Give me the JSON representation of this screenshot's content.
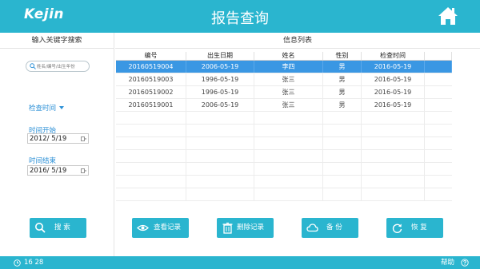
{
  "header": {
    "logo": "Kejin",
    "title": "报告查询"
  },
  "left_panel": {
    "title": "输入关键字搜索",
    "search_placeholder": "姓名/编号/出生年份",
    "filter_label": "检查时间",
    "start_label": "时间开始",
    "start_value": "2012/  5/19",
    "end_label": "时间结束",
    "end_value": "2016/  5/19"
  },
  "info_list": {
    "title": "信息列表",
    "columns": [
      "编号",
      "出生日期",
      "姓名",
      "性别",
      "检查时间"
    ],
    "rows": [
      [
        "20160519004",
        "2006-05-19",
        "李四",
        "男",
        "2016-05-19"
      ],
      [
        "20160519003",
        "1996-05-19",
        "张三",
        "男",
        "2016-05-19"
      ],
      [
        "20160519002",
        "1996-05-19",
        "张三",
        "男",
        "2016-05-19"
      ],
      [
        "20160519001",
        "2006-05-19",
        "张三",
        "男",
        "2016-05-19"
      ]
    ]
  },
  "buttons": {
    "search": "搜  索",
    "view": "查看记录",
    "delete": "删除记录",
    "backup": "备  份",
    "restore": "恢  复"
  },
  "footer": {
    "time": "16  28",
    "help": "帮助"
  },
  "colors": {
    "accent": "#2ab5cf",
    "selected_row": "#3a97e3",
    "link": "#2a8fd6"
  },
  "icons": [
    "home-icon",
    "search-icon",
    "calendar-icon",
    "eye-icon",
    "trash-icon",
    "cloud-icon",
    "refresh-icon",
    "clock-icon",
    "help-icon"
  ]
}
